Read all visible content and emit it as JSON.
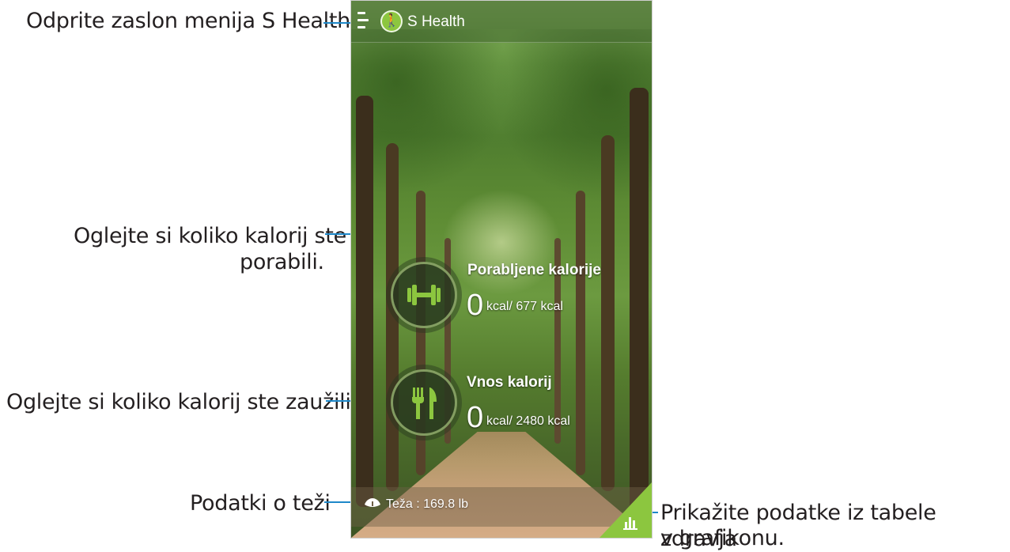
{
  "callouts": {
    "menu": "Odprite zaslon menija S Health.",
    "burned_line1": "Oglejte si koliko kalorij ste",
    "burned_line2": "porabili.",
    "intake": "Oglejte si koliko kalorij ste zaužili.",
    "weight": "Podatki o teži",
    "chart_line1": "Prikažite podatke iz tabele zdravja",
    "chart_line2": "v grafikonu."
  },
  "app": {
    "title": "S Health",
    "menu_icon": "hamburger-menu-icon",
    "logo_icon": "walking-person-icon"
  },
  "burned": {
    "title": "Porabljene kalorije",
    "value": "0",
    "unit": "kcal/ 677 kcal",
    "icon": "dumbbell-icon"
  },
  "intake": {
    "title": "Vnos kalorij",
    "value": "0",
    "unit": "kcal/ 2480 kcal",
    "icon": "fork-knife-icon"
  },
  "weight": {
    "text": "Teža : 169.8 lb",
    "icon": "scale-icon"
  },
  "chart_button": {
    "icon": "bar-chart-icon"
  },
  "colors": {
    "callout_line": "#1e88c9",
    "accent_green": "#8cc63f"
  }
}
